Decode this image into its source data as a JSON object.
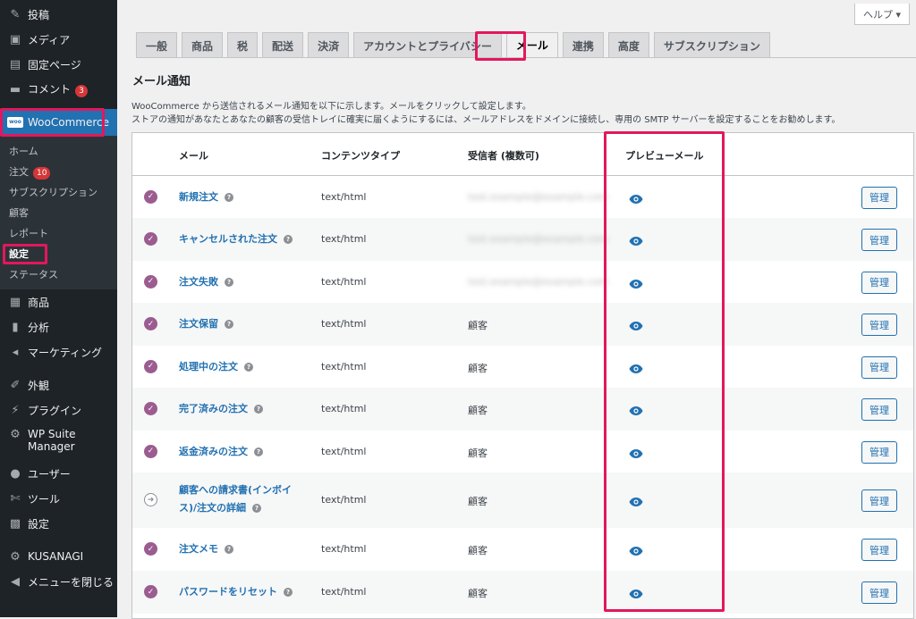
{
  "sidebar": {
    "items": [
      {
        "label": "投稿",
        "icon": "pin-icon"
      },
      {
        "label": "メディア",
        "icon": "media-icon"
      },
      {
        "label": "固定ページ",
        "icon": "page-icon"
      },
      {
        "label": "コメント",
        "icon": "comment-icon",
        "badge": "3"
      },
      {
        "label": "WooCommerce",
        "icon": "woo-icon",
        "logo": "woo"
      },
      {
        "label": "商品",
        "icon": "products-icon"
      },
      {
        "label": "分析",
        "icon": "analytics-icon"
      },
      {
        "label": "マーケティング",
        "icon": "marketing-icon"
      },
      {
        "label": "外観",
        "icon": "appearance-icon"
      },
      {
        "label": "プラグイン",
        "icon": "plugin-icon"
      },
      {
        "label": "WP Suite",
        "label2": "Manager",
        "icon": "gear-icon"
      },
      {
        "label": "ユーザー",
        "icon": "user-icon"
      },
      {
        "label": "ツール",
        "icon": "wrench-icon"
      },
      {
        "label": "設定",
        "icon": "settings-icon"
      },
      {
        "label": "KUSANAGI",
        "icon": "gear-icon"
      },
      {
        "label": "メニューを閉じる",
        "icon": "collapse-icon"
      }
    ],
    "submenu": [
      {
        "label": "ホーム"
      },
      {
        "label": "注文",
        "badge": "10"
      },
      {
        "label": "サブスクリプション"
      },
      {
        "label": "顧客"
      },
      {
        "label": "レポート"
      },
      {
        "label": "設定",
        "current": true
      },
      {
        "label": "ステータス"
      }
    ]
  },
  "header": {
    "help_label": "ヘルプ ▾"
  },
  "tabs": [
    {
      "label": "一般"
    },
    {
      "label": "商品"
    },
    {
      "label": "税"
    },
    {
      "label": "配送"
    },
    {
      "label": "決済"
    },
    {
      "label": "アカウントとプライバシー"
    },
    {
      "label": "メール",
      "active": true
    },
    {
      "label": "連携"
    },
    {
      "label": "高度"
    },
    {
      "label": "サブスクリプション"
    }
  ],
  "section": {
    "title": "メール通知",
    "desc1": "WooCommerce から送信されるメール通知を以下に示します。メールをクリックして設定します。",
    "desc2": "ストアの通知があなたとあなたの顧客の受信トレイに確実に届くようにするには、メールアドレスをドメインに接続し、専用の SMTP サーバーを設定することをお勧めします。"
  },
  "table": {
    "headers": {
      "email": "メール",
      "content_type": "コンテンツタイプ",
      "recipients": "受信者 (複数可)",
      "preview": "プレビューメール"
    },
    "manage_label": "管理",
    "rows": [
      {
        "name": "新規注文",
        "type": "text/html",
        "recipient": "test.example@example.com",
        "blurred": true,
        "status": "enabled"
      },
      {
        "name": "キャンセルされた注文",
        "type": "text/html",
        "recipient": "test.example@example.com",
        "blurred": true,
        "status": "enabled"
      },
      {
        "name": "注文失敗",
        "type": "text/html",
        "recipient": "test.example@example.com",
        "blurred": true,
        "status": "enabled"
      },
      {
        "name": "注文保留",
        "type": "text/html",
        "recipient": "顧客",
        "status": "enabled"
      },
      {
        "name": "処理中の注文",
        "type": "text/html",
        "recipient": "顧客",
        "status": "enabled"
      },
      {
        "name": "完了済みの注文",
        "type": "text/html",
        "recipient": "顧客",
        "status": "enabled"
      },
      {
        "name": "返金済みの注文",
        "type": "text/html",
        "recipient": "顧客",
        "status": "enabled"
      },
      {
        "name": "顧客への請求書(インボイ",
        "name2": "ス)/注文の詳細",
        "type": "text/html",
        "recipient": "顧客",
        "status": "manual"
      },
      {
        "name": "注文メモ",
        "type": "text/html",
        "recipient": "顧客",
        "status": "enabled"
      },
      {
        "name": "パスワードをリセット",
        "type": "text/html",
        "recipient": "顧客",
        "status": "enabled"
      }
    ]
  },
  "colors": {
    "accent": "#2271b1",
    "highlight": "#e3175d",
    "woo_purple": "#9b5c8f",
    "sidebar_bg": "#1d2327"
  }
}
